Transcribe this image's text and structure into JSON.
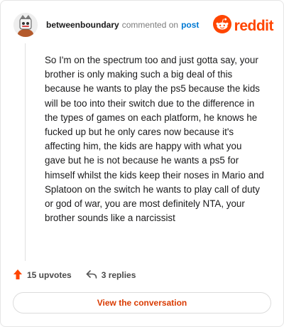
{
  "header": {
    "username": "betweenboundary",
    "action": "commented on",
    "post_link": "post",
    "brand": "reddit"
  },
  "comment": {
    "text": "So I'm on the spectrum too and just gotta say, your brother is only making such a big deal of this because he wants to play the ps5 because the kids will be too into their switch due to the difference in the types of games on each platform, he knows he fucked up but he only cares now because it's affecting him, the kids are happy with what you gave but he is not because he wants a ps5 for himself whilst the kids keep their noses in Mario and Splatoon on the switch he wants to play call of duty or god of war, you are most definitely NTA, your brother sounds like a narcissist"
  },
  "actions": {
    "upvotes": "15 upvotes",
    "replies": "3 replies"
  },
  "cta": {
    "label": "View the conversation"
  },
  "colors": {
    "brand": "#ff4500",
    "link": "#0079d3",
    "cta_text": "#d93a00"
  },
  "icons": {
    "avatar": "snoo-avatar-icon",
    "brand_logo": "reddit-logo-icon",
    "upvote": "upvote-arrow-icon",
    "reply": "reply-arrow-icon"
  }
}
